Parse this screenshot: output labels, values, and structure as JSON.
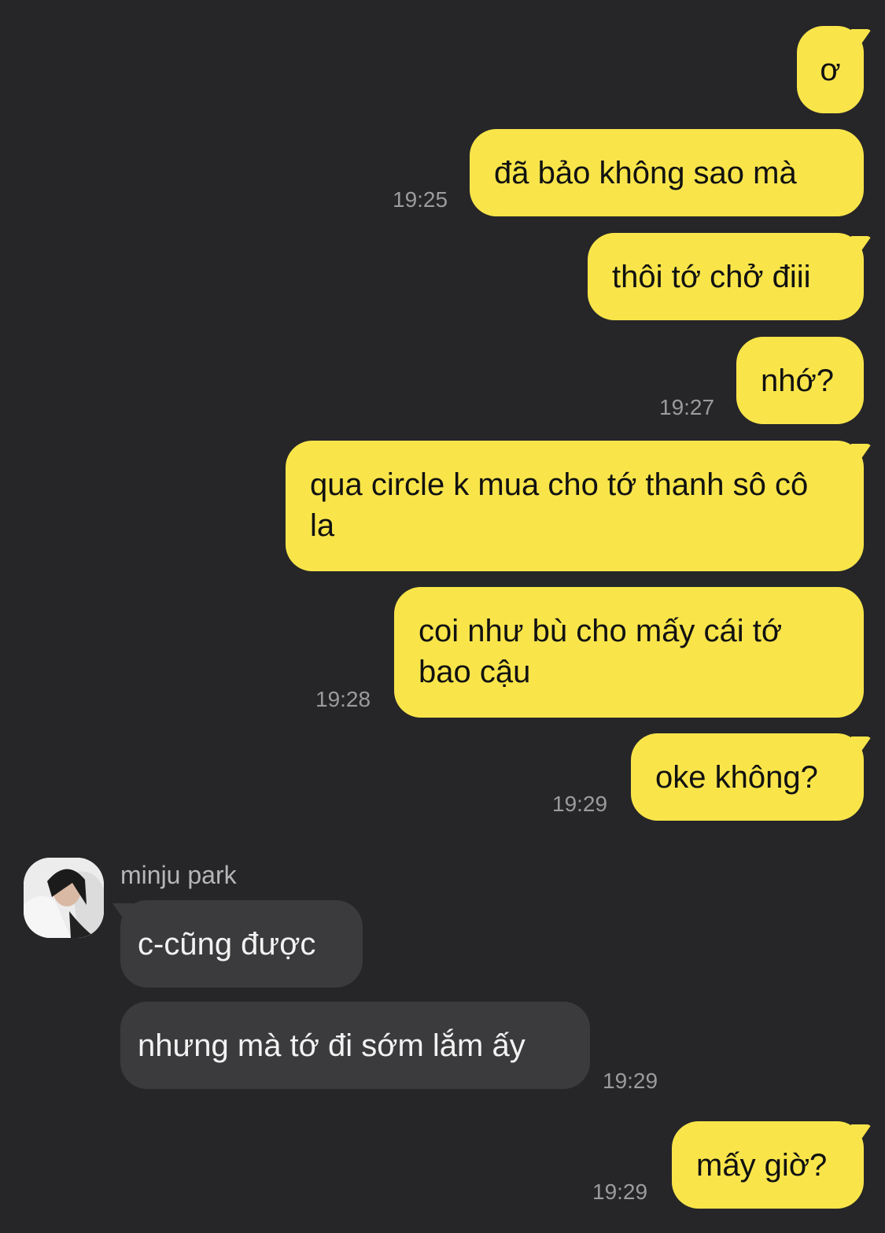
{
  "sender": {
    "name": "minju park"
  },
  "messages": [
    {
      "text": "ơ"
    },
    {
      "text": "đã bảo không sao mà",
      "time": "19:25"
    },
    {
      "text": "thôi tớ chở điii"
    },
    {
      "text": "nhớ?",
      "time": "19:27"
    },
    {
      "text": "qua circle k mua cho tớ thanh sô cô la"
    },
    {
      "text": "coi như bù cho mấy cái tớ bao cậu",
      "time": "19:28"
    },
    {
      "text": "oke không?",
      "time": "19:29"
    },
    {
      "text": "c-cũng được"
    },
    {
      "text": "nhưng mà tớ đi sớm lắm ấy",
      "time": "19:29"
    },
    {
      "text": "mấy giờ?",
      "time": "19:29"
    }
  ],
  "colors": {
    "outgoing": "#f9e54a",
    "incoming": "#3b3b3d",
    "background": "#262628"
  },
  "icons": {
    "avatar": "profile-photo"
  }
}
